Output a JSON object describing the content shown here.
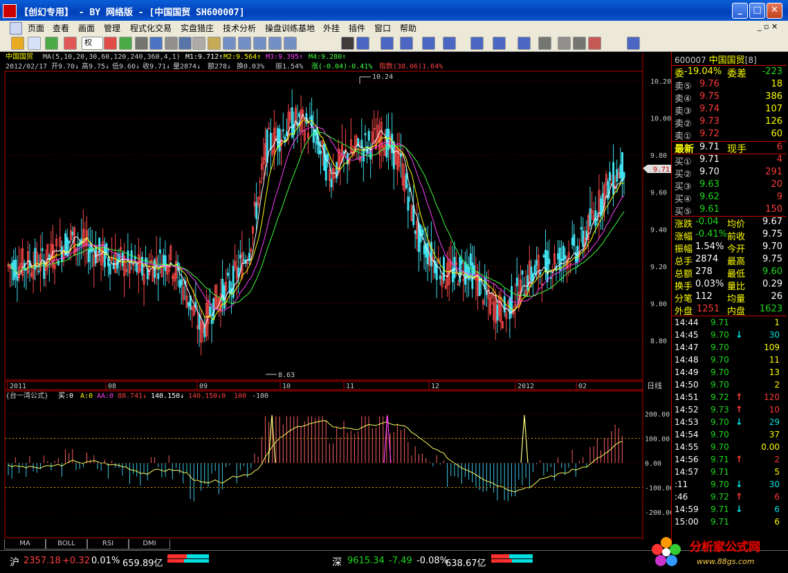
{
  "window": {
    "title": "【创幻专用】 - BY 网络版 - [中国国贸 SH600007]"
  },
  "menu": [
    "页面",
    "查看",
    "画面",
    "管理",
    "程式化交易",
    "实盘猎庄",
    "技术分析",
    "操盘训练基地",
    "外挂",
    "插件",
    "窗口",
    "帮助"
  ],
  "toolbar": {
    "period": "权"
  },
  "stock": {
    "name": "中国国贸",
    "code": "600007",
    "rank": "[8]"
  },
  "ma_line": {
    "label": "MA(5,10,20,30,60,120,240,360,4,1)",
    "m1": "M1:9.712↑",
    "m2": "M2:9.564↑",
    "m3": "M3:9.395↑",
    "m4": "M4:9.280↑"
  },
  "info_line": {
    "date": "2012/02/17",
    "open": "开9.70↓",
    "high": "高9.75↓",
    "low": "低9.60↓",
    "close": "收9.71↓",
    "vol": "量2874↓",
    "amt": "额278↓",
    "turn": "换0.03%",
    "amp": "振1.54%",
    "chg": "涨(-0.04)-0.41%",
    "idx": "指数(38.06)1.64%"
  },
  "price_axis": [
    "10.20",
    "10.00",
    "9.80",
    "9.60",
    "9.40",
    "9.20",
    "9.00",
    "8.80"
  ],
  "cur_price_tag": "9.71",
  "high_mark": "10.24",
  "low_mark": "8.63",
  "date_axis": [
    "2011",
    "08",
    "09",
    "10",
    "11",
    "12",
    "2012",
    "02"
  ],
  "period_label": "日线",
  "indicator": {
    "name": "{台一湾公式}",
    "buy": "买:0",
    "a": "A:0",
    "aa": "AA:0",
    "v1": "88.741↓",
    "v2": "140.150↓",
    "v3": "140.150↓0",
    "v4": "100",
    "v5": "-100"
  },
  "ind_axis": [
    "200.00",
    "100.00",
    "0.00",
    "-100.00",
    "-200.00"
  ],
  "bottom_tabs": [
    "MA",
    "BOLL",
    "RSI",
    "DMI"
  ],
  "quote": {
    "header": {
      "code": "600007",
      "name": "中国国贸",
      "rank": "[8]"
    },
    "weibi": {
      "label": "委",
      "val": "-19.04%",
      "label2": "委差",
      "val2": "-223"
    },
    "sells": [
      {
        "label": "卖⑤",
        "price": "9.76",
        "vol": "18"
      },
      {
        "label": "卖④",
        "price": "9.75",
        "vol": "386"
      },
      {
        "label": "卖③",
        "price": "9.74",
        "vol": "107"
      },
      {
        "label": "卖②",
        "price": "9.73",
        "vol": "126"
      },
      {
        "label": "卖①",
        "price": "9.72",
        "vol": "60"
      }
    ],
    "latest": {
      "label": "最新",
      "price": "9.71",
      "label2": "现手",
      "vol": "6"
    },
    "buys": [
      {
        "label": "买①",
        "price": "9.71",
        "vol": "4"
      },
      {
        "label": "买②",
        "price": "9.70",
        "vol": "291"
      },
      {
        "label": "买③",
        "price": "9.63",
        "vol": "20"
      },
      {
        "label": "买④",
        "price": "9.62",
        "vol": "9"
      },
      {
        "label": "买⑤",
        "price": "9.61",
        "vol": "150"
      }
    ],
    "stats": [
      {
        "l1": "涨跌",
        "v1": "-0.04",
        "l2": "均价",
        "v2": "9.67"
      },
      {
        "l1": "涨幅",
        "v1": "-0.41%",
        "l2": "前收",
        "v2": "9.75"
      },
      {
        "l1": "振幅",
        "v1": "1.54%",
        "l2": "今开",
        "v2": "9.70"
      },
      {
        "l1": "总手",
        "v1": "2874",
        "l2": "最高",
        "v2": "9.75"
      },
      {
        "l1": "总额",
        "v1": "278",
        "l2": "最低",
        "v2": "9.60"
      },
      {
        "l1": "换手",
        "v1": "0.03%",
        "l2": "量比",
        "v2": "0.29"
      },
      {
        "l1": "分笔",
        "v1": "112",
        "l2": "均量",
        "v2": "26"
      }
    ],
    "outer": {
      "l1": "外盘",
      "v1": "1251",
      "l2": "内盘",
      "v2": "1623"
    },
    "ticks": [
      {
        "t": "14:44",
        "p": "9.71",
        "a": "",
        "v": "1"
      },
      {
        "t": "14:45",
        "p": "9.70",
        "a": "↓",
        "v": "30"
      },
      {
        "t": "14:47",
        "p": "9.70",
        "a": "",
        "v": "109"
      },
      {
        "t": "14:48",
        "p": "9.70",
        "a": "",
        "v": "11"
      },
      {
        "t": "14:49",
        "p": "9.70",
        "a": "",
        "v": "13"
      },
      {
        "t": "14:50",
        "p": "9.70",
        "a": "",
        "v": "2"
      },
      {
        "t": "14:51",
        "p": "9.72",
        "a": "↑",
        "v": "120"
      },
      {
        "t": "14:52",
        "p": "9.73",
        "a": "↑",
        "v": "10"
      },
      {
        "t": "14:53",
        "p": "9.70",
        "a": "↓",
        "v": "29"
      },
      {
        "t": "14:54",
        "p": "9.70",
        "a": "",
        "v": "37"
      },
      {
        "t": "14:55",
        "p": "9.70",
        "a": "",
        "v": "0.00"
      },
      {
        "t": "14:56",
        "p": "9.71",
        "a": "↑",
        "v": "2"
      },
      {
        "t": "14:57",
        "p": "9.71",
        "a": "",
        "v": "5"
      },
      {
        "t": ":11",
        "p": "9.70",
        "a": "↓",
        "v": "30"
      },
      {
        "t": ":46",
        "p": "9.72",
        "a": "↑",
        "v": "6"
      },
      {
        "t": "14:59",
        "p": "9.71",
        "a": "↓",
        "v": "6"
      },
      {
        "t": "15:00",
        "p": "9.71",
        "a": "",
        "v": "6"
      }
    ]
  },
  "status": {
    "sh": {
      "label": "沪",
      "index": "2357.18",
      "chg": "+0.32",
      "pct": "0.01%",
      "amt": "659.89亿"
    },
    "sz": {
      "label": "深",
      "index": "9615.34",
      "chg": "-7.49",
      "pct": "-0.08%",
      "amt": "638.67亿"
    }
  },
  "watermark": {
    "text": "分析家公式网",
    "url": "www.88gs.com"
  }
}
